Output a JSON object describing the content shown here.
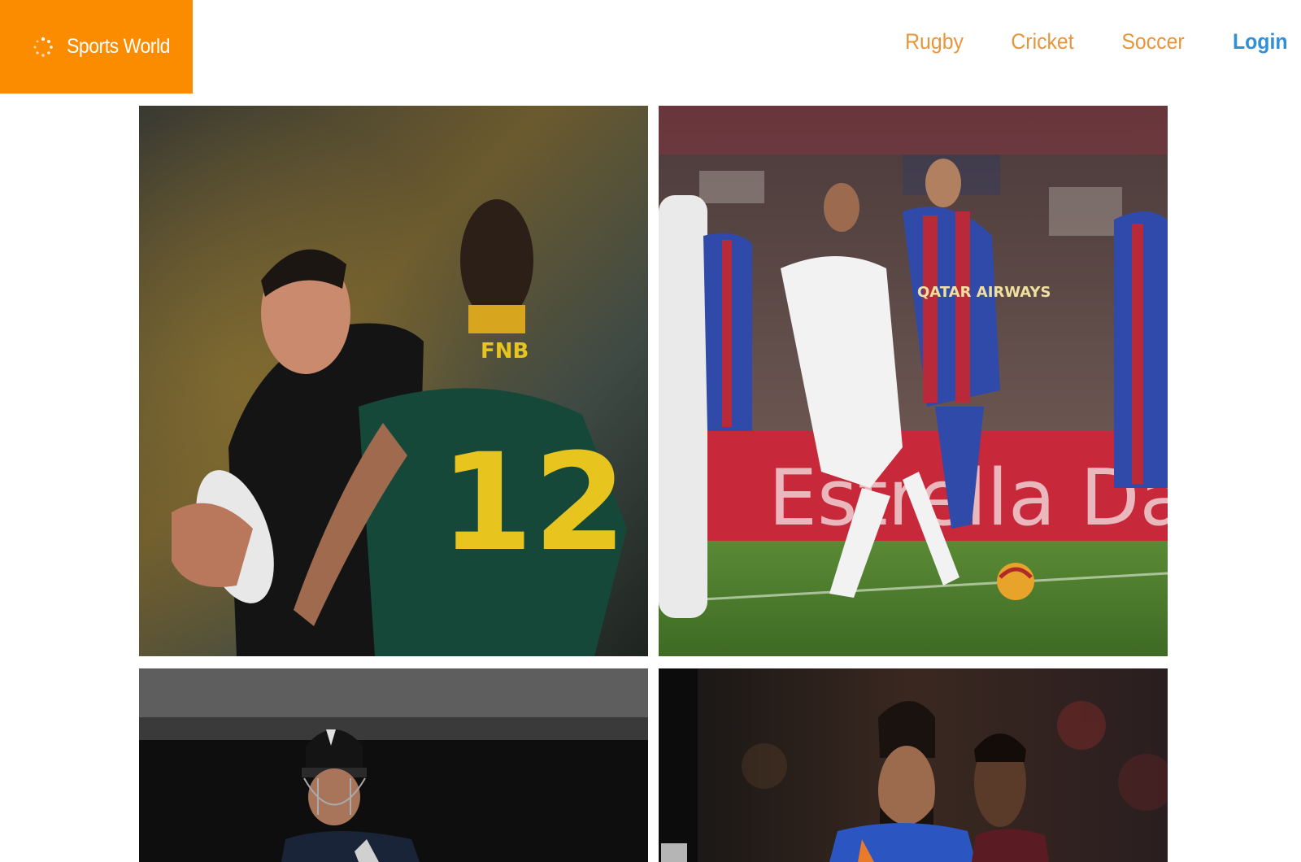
{
  "brand": {
    "title": "Sports World",
    "icon": "loader-dots-icon",
    "color": "#fb8c00"
  },
  "nav": {
    "items": [
      {
        "label": "Rugby"
      },
      {
        "label": "Cricket"
      },
      {
        "label": "Soccer"
      }
    ],
    "login_label": "Login",
    "link_color": "#e8953a",
    "login_color": "#2f8fd8"
  },
  "tiles": [
    {
      "name": "rugby",
      "number": "12",
      "sponsor": "FNB"
    },
    {
      "name": "soccer",
      "ad_text": "Estrella Damm",
      "shirt_text": "QATAR AIRWAYS"
    },
    {
      "name": "cricket"
    },
    {
      "name": "basketball"
    }
  ]
}
